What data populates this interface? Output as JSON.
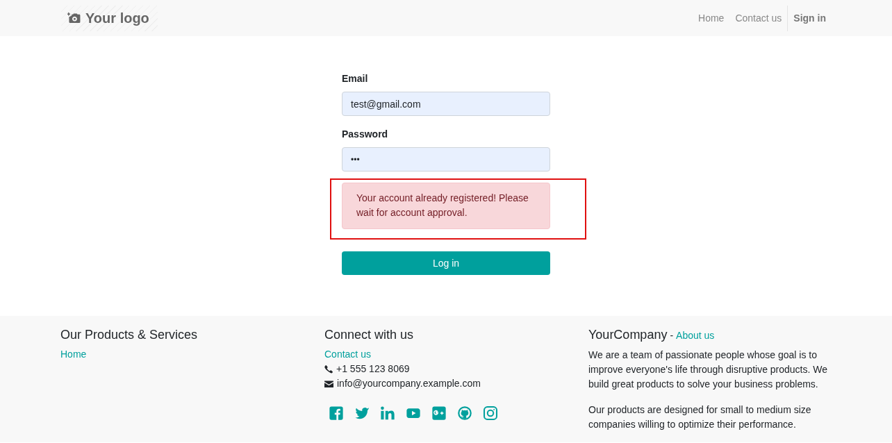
{
  "header": {
    "logo": "Your logo",
    "nav": [
      {
        "label": "Home",
        "kind": "link"
      },
      {
        "label": "Contact us",
        "kind": "link"
      },
      {
        "label": "Sign in",
        "kind": "account"
      }
    ]
  },
  "login_form": {
    "fields": [
      {
        "label": "Email",
        "value": "test@gmail.com",
        "kind": "text"
      },
      {
        "label": "Password",
        "value": "•••",
        "kind": "password"
      }
    ],
    "alert": {
      "message": "Your account already registered! Please wait for account approval.",
      "highlighted": true
    },
    "submit": "Log in"
  },
  "footer": {
    "columns": [
      {
        "kind": "links",
        "title": "Our Products & Services",
        "links": [
          "Home"
        ]
      },
      {
        "kind": "contact",
        "title": "Connect with us",
        "links": [
          "Contact us"
        ],
        "contacts": [
          {
            "kind": "phone",
            "text": "+1 555 123 8069"
          },
          {
            "kind": "email",
            "text": "info@yourcompany.example.com"
          }
        ]
      },
      {
        "kind": "about",
        "title": "YourCompany",
        "separator": "-",
        "link": "About us",
        "paragraphs": [
          "We are a team of passionate people whose goal is to improve everyone's life through disruptive products. We build great products to solve your business problems.",
          "Our products are designed for small to medium size companies willing to optimize their performance."
        ]
      }
    ]
  }
}
